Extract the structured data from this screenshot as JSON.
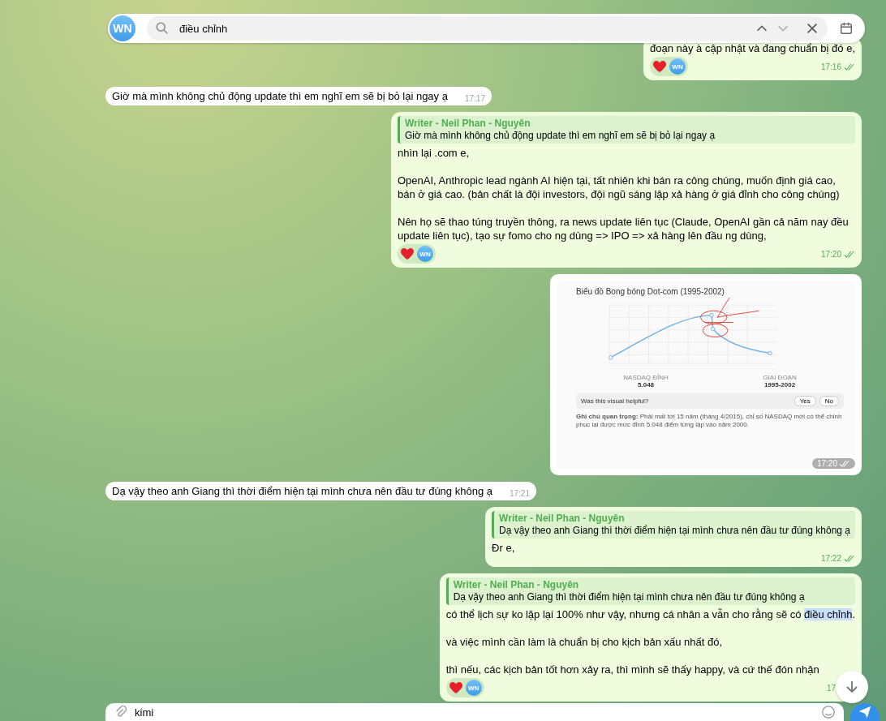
{
  "search": {
    "avatar": "WN",
    "query": "điều chỉnh"
  },
  "messages": [
    {
      "kind": "text",
      "outgoing": true,
      "paragraphs": [
        [
          {
            "text": "đoạn này à cập nhật và đang chuẩn bị đó e,",
            "match": false
          }
        ]
      ],
      "reactor": "WN",
      "time": "17:16",
      "read": true
    },
    {
      "kind": "text",
      "outgoing": false,
      "paragraphs": [
        [
          {
            "text": "Giờ mà mình không chủ động update thì em nghĩ em sẽ bị bỏ lại ngay ạ",
            "match": false
          }
        ]
      ],
      "time": "17:17"
    },
    {
      "kind": "text",
      "outgoing": true,
      "quote": {
        "author": "Writer - Neil Phan - Nguyên",
        "text": "Giờ mà mình không chủ động update thì em nghĩ em sẽ bị bỏ lại ngay ạ"
      },
      "paragraphs": [
        [
          {
            "text": "nhìn lại .com e,",
            "match": false
          }
        ],
        [
          {
            "text": "OpenAI, Anthropic lead ngành AI hiện tại, tất nhiên khi bán ra công chúng, muốn định giá cao, bán ở giá cao. (bản chất là đội investors, đội ngũ sáng lập xả hàng ở giá đỉnh cho công chúng)",
            "match": false
          }
        ],
        [
          {
            "text": "Nên họ sẽ thao túng truyền thông, ra news update liên tục (Claude, OpenAI gần cả năm nay đều update liên tục), tạo sự fomo cho ng dùng => IPO => xả hàng lên đầu ng dùng,",
            "match": false
          }
        ]
      ],
      "reactor": "WN",
      "time": "17:20",
      "read": true
    },
    {
      "kind": "image",
      "outgoing": true,
      "screenshot": {
        "title": "Biểu đồ Bong bóng Dot-com (1995-2002)",
        "stats": [
          {
            "label": "NASDAQ ĐỈNH",
            "value": "5.048"
          },
          {
            "label": "GIAI ĐOẠN",
            "value": "1995-2002"
          }
        ],
        "question": "Was this visual helpful?",
        "answers": [
          "Yes",
          "No"
        ],
        "note": "**Ghi chú quan trọng:** Phải mất tới 15 năm (tháng 4/2015), chỉ số NASDAQ mới có thể chinh phục lại được mức đỉnh 5.048 điểm từng lập vào năm 2000."
      },
      "time": "17:20",
      "read": true
    },
    {
      "kind": "text",
      "outgoing": false,
      "paragraphs": [
        [
          {
            "text": "Dạ vậy theo anh Giang thì thời điểm hiện tại mình chưa nên đầu tư đúng không ạ",
            "match": false
          }
        ]
      ],
      "time": "17:21"
    },
    {
      "kind": "text",
      "outgoing": true,
      "quote": {
        "author": "Writer - Neil Phan - Nguyên",
        "text": "Dạ vậy theo anh Giang thì thời điểm hiện tại mình chưa nên đầu tư đúng không ạ"
      },
      "paragraphs": [
        [
          {
            "text": "Đr e,",
            "match": false
          }
        ]
      ],
      "time": "17:22",
      "read": true
    },
    {
      "kind": "text",
      "outgoing": true,
      "quote": {
        "author": "Writer - Neil Phan - Nguyên",
        "text": "Dạ vậy theo anh Giang thì thời điểm hiện tại mình chưa nên đầu tư đúng không ạ"
      },
      "paragraphs": [
        [
          {
            "text": "có thể lịch sự ko lặp lại 100% như vậy, nhưng cá nhân a vẫn cho rằng sẽ có ",
            "match": false
          },
          {
            "text": "điều chỉnh",
            "match": true
          },
          {
            "text": ".",
            "match": false
          }
        ],
        [
          {
            "text": "và việc mình cần làm là chuẩn bị cho kịch bản xấu nhất đó,",
            "match": false
          }
        ],
        [
          {
            "text": "thì nếu, các kịch bản tốt hơn xảy ra, thì mình sẽ thấy happy, và cứ thế đón nhận",
            "match": false
          }
        ]
      ],
      "reactor": "WN",
      "time": "17"
    }
  ],
  "composer": {
    "value": "kimi"
  }
}
